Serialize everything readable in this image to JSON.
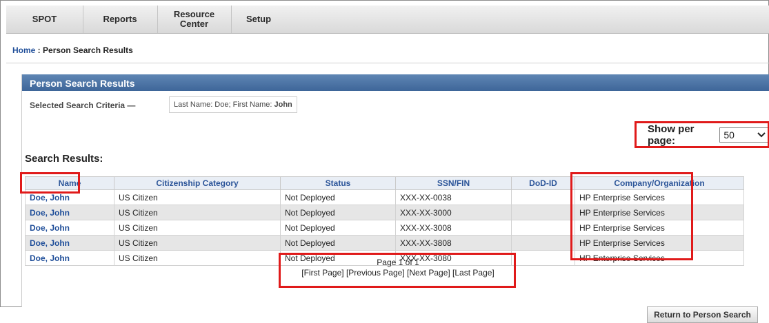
{
  "nav": {
    "items": [
      {
        "label": "SPOT"
      },
      {
        "label": "Reports"
      },
      {
        "label_line1": "Resource",
        "label_line2": "Center"
      },
      {
        "label": "Setup"
      }
    ]
  },
  "breadcrumb": {
    "home": "Home",
    "separator": " : ",
    "current": "Person Search Results"
  },
  "panel": {
    "title": "Person Search Results",
    "criteria_label": "Selected Search Criteria —",
    "criteria_prefix": "Last Name: Doe; First Name: ",
    "criteria_first_name": "John",
    "results_title": "Search Results:",
    "per_page_label": "Show per page:",
    "per_page_value": "50"
  },
  "table": {
    "headers": [
      "Name",
      "Citizenship Category",
      "Status",
      "SSN/FIN",
      "DoD-ID",
      "Company/Organization"
    ],
    "rows": [
      {
        "name": "Doe, John",
        "citizenship": "US Citizen",
        "status": "Not Deployed",
        "ssn": "XXX-XX-0038",
        "dodid": "",
        "company": "HP Enterprise Services"
      },
      {
        "name": "Doe, John",
        "citizenship": "US Citizen",
        "status": "Not Deployed",
        "ssn": "XXX-XX-3000",
        "dodid": "",
        "company": "HP Enterprise Services"
      },
      {
        "name": "Doe, John",
        "citizenship": "US Citizen",
        "status": "Not Deployed",
        "ssn": "XXX-XX-3008",
        "dodid": "",
        "company": "HP Enterprise Services"
      },
      {
        "name": "Doe, John",
        "citizenship": "US Citizen",
        "status": "Not Deployed",
        "ssn": "XXX-XX-3808",
        "dodid": "",
        "company": "HP Enterprise Services"
      },
      {
        "name": "Doe, John",
        "citizenship": "US Citizen",
        "status": "Not Deployed",
        "ssn": "XXX-XX-3080",
        "dodid": "",
        "company": "HP Enterprise Services"
      }
    ]
  },
  "pager": {
    "page_info": "Page 1 of 1",
    "first": "[First Page]",
    "previous": "[Previous Page]",
    "next": "[Next Page]",
    "last": "[Last Page]"
  },
  "return_button": "Return to Person Search",
  "colors": {
    "highlight": "#e01a1a",
    "link": "#1f4e99",
    "header_blue": "#3e6699"
  },
  "icons": {
    "select_arrow": "chevron-down-icon"
  }
}
